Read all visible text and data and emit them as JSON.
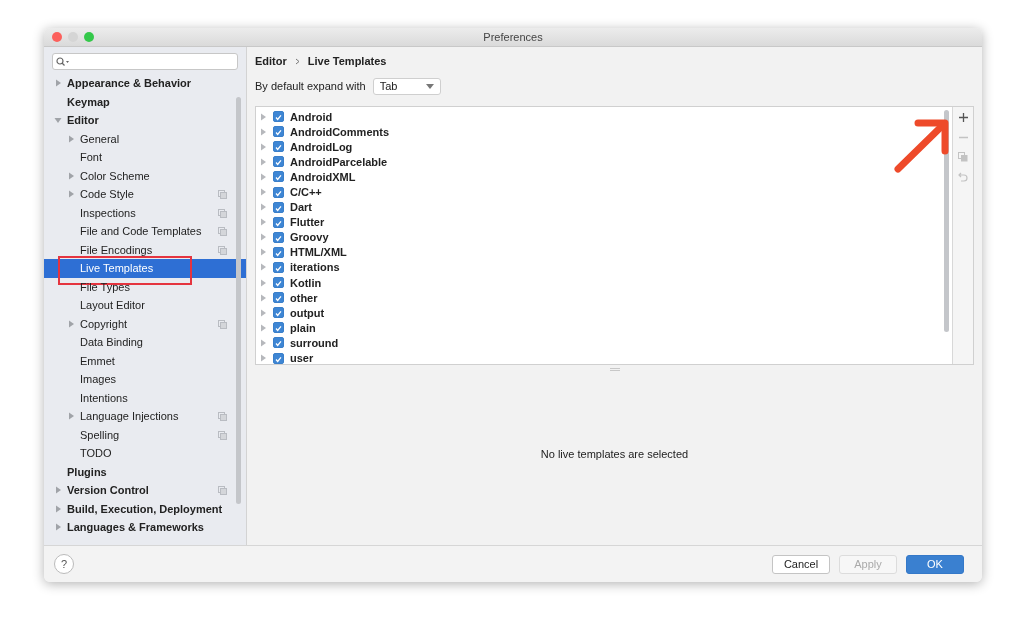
{
  "window": {
    "title": "Preferences"
  },
  "sidebar": {
    "items": [
      {
        "label": "Appearance & Behavior",
        "expanded": false,
        "selected": false
      },
      {
        "label": "Keymap",
        "selected": false
      },
      {
        "label": "Editor",
        "expanded": true,
        "selected": false,
        "children": [
          {
            "label": "General",
            "expanded": false,
            "selected": false
          },
          {
            "label": "Font",
            "selected": false
          },
          {
            "label": "Color Scheme",
            "expanded": false,
            "selected": false
          },
          {
            "label": "Code Style",
            "expanded": false,
            "selected": false,
            "project_level": true
          },
          {
            "label": "Inspections",
            "selected": false,
            "project_level": true
          },
          {
            "label": "File and Code Templates",
            "selected": false,
            "project_level": true
          },
          {
            "label": "File Encodings",
            "selected": false,
            "project_level": true
          },
          {
            "label": "Live Templates",
            "selected": true,
            "annotated": true
          },
          {
            "label": "File Types",
            "selected": false
          },
          {
            "label": "Layout Editor",
            "selected": false
          },
          {
            "label": "Copyright",
            "expanded": false,
            "selected": false,
            "project_level": true
          },
          {
            "label": "Data Binding",
            "selected": false
          },
          {
            "label": "Emmet",
            "selected": false
          },
          {
            "label": "Images",
            "selected": false
          },
          {
            "label": "Intentions",
            "selected": false
          },
          {
            "label": "Language Injections",
            "expanded": false,
            "selected": false,
            "project_level": true
          },
          {
            "label": "Spelling",
            "selected": false,
            "project_level": true
          },
          {
            "label": "TODO",
            "selected": false
          }
        ]
      },
      {
        "label": "Plugins",
        "selected": false
      },
      {
        "label": "Version Control",
        "expanded": false,
        "selected": false,
        "project_level": true
      },
      {
        "label": "Build, Execution, Deployment",
        "expanded": false,
        "selected": false
      },
      {
        "label": "Languages & Frameworks",
        "expanded": false,
        "selected": false
      }
    ]
  },
  "breadcrumb": [
    "Editor",
    "Live Templates"
  ],
  "expand_with": {
    "label": "By default expand with",
    "value": "Tab"
  },
  "templates": [
    {
      "label": "Android",
      "checked": true,
      "expanded": false
    },
    {
      "label": "AndroidComments",
      "checked": true,
      "expanded": false
    },
    {
      "label": "AndroidLog",
      "checked": true,
      "expanded": false
    },
    {
      "label": "AndroidParcelable",
      "checked": true,
      "expanded": false
    },
    {
      "label": "AndroidXML",
      "checked": true,
      "expanded": false
    },
    {
      "label": "C/C++",
      "checked": true,
      "expanded": false
    },
    {
      "label": "Dart",
      "checked": true,
      "expanded": false
    },
    {
      "label": "Flutter",
      "checked": true,
      "expanded": false
    },
    {
      "label": "Groovy",
      "checked": true,
      "expanded": false
    },
    {
      "label": "HTML/XML",
      "checked": true,
      "expanded": false
    },
    {
      "label": "iterations",
      "checked": true,
      "expanded": false
    },
    {
      "label": "Kotlin",
      "checked": true,
      "expanded": false
    },
    {
      "label": "other",
      "checked": true,
      "expanded": false
    },
    {
      "label": "output",
      "checked": true,
      "expanded": false
    },
    {
      "label": "plain",
      "checked": true,
      "expanded": false
    },
    {
      "label": "surround",
      "checked": true,
      "expanded": false
    },
    {
      "label": "user",
      "checked": true,
      "expanded": false
    }
  ],
  "toolbar": [
    {
      "kind": "add",
      "disabled": false,
      "annotated": true
    },
    {
      "kind": "remove",
      "disabled": true,
      "annotated": false
    },
    {
      "kind": "copy",
      "disabled": true,
      "annotated": false
    },
    {
      "kind": "restore",
      "disabled": true,
      "annotated": false
    }
  ],
  "details_message": "No live templates are selected",
  "help": "?",
  "buttons": [
    {
      "label": "Cancel",
      "kind": "default",
      "disabled": false
    },
    {
      "label": "Apply",
      "kind": "default",
      "disabled": true
    },
    {
      "label": "OK",
      "kind": "primary",
      "disabled": false
    }
  ]
}
